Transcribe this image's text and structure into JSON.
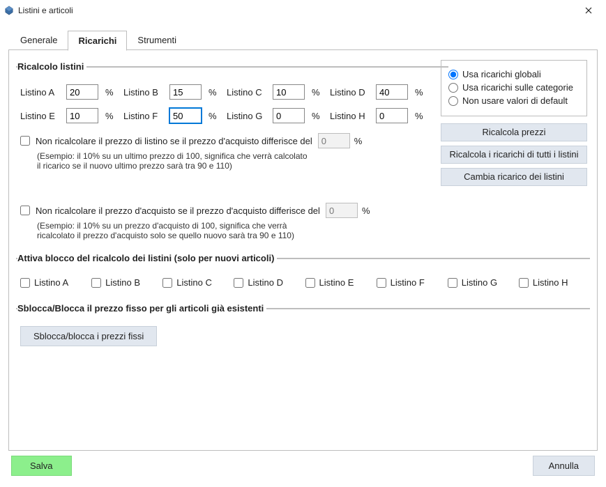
{
  "window": {
    "title": "Listini e articoli"
  },
  "tabs": {
    "generale": "Generale",
    "ricarichi": "Ricarichi",
    "strumenti": "Strumenti",
    "active": "ricarichi"
  },
  "ricalcolo": {
    "legend": "Ricalcolo listini",
    "percent_sign": "%",
    "listini": {
      "a_label": "Listino A",
      "a_value": "20",
      "b_label": "Listino B",
      "b_value": "15",
      "c_label": "Listino C",
      "c_value": "10",
      "d_label": "Listino D",
      "d_value": "40",
      "e_label": "Listino E",
      "e_value": "10",
      "f_label": "Listino F",
      "f_value": "50",
      "g_label": "Listino G",
      "g_value": "0",
      "h_label": "Listino H",
      "h_value": "0"
    },
    "no_recal_listino_label": "Non ricalcolare il prezzo di listino se il prezzo d'acquisto differisce del",
    "no_recal_listino_value": "0",
    "no_recal_listino_example": "(Esempio: il 10% su un ultimo prezzo di 100, significa che verrà calcolato il ricarico se il nuovo ultimo prezzo sarà tra 90 e 110)",
    "no_recal_acquisto_label": "Non ricalcolare il prezzo d'acquisto se il prezzo d'acquisto differisce del",
    "no_recal_acquisto_value": "0",
    "no_recal_acquisto_example": "(Esempio: il 10% su un prezzo d'acquisto di 100, significa che verrà ricalcolato il prezzo d'acquisto solo se quello nuovo sarà tra 90 e 110)"
  },
  "defaults_mode": {
    "globali": "Usa ricarichi globali",
    "categorie": "Usa ricarichi sulle categorie",
    "nessuno": "Non usare valori di default",
    "selected": "globali"
  },
  "buttons": {
    "ricalcola_prezzi": "Ricalcola prezzi",
    "ricalcola_tutti": "Ricalcola i ricarichi di tutti i listini",
    "cambia_ricarico": "Cambia ricarico dei listini",
    "sblocca_blocca": "Sblocca/blocca i prezzi fissi",
    "salva": "Salva",
    "annulla": "Annulla"
  },
  "blocco": {
    "legend": "Attiva blocco del ricalcolo dei listini (solo per nuovi articoli)",
    "items": {
      "a": "Listino A",
      "b": "Listino B",
      "c": "Listino C",
      "d": "Listino D",
      "e": "Listino E",
      "f": "Listino F",
      "g": "Listino G",
      "h": "Listino H"
    }
  },
  "sblocca": {
    "legend": "Sblocca/Blocca il prezzo fisso per gli articoli già esistenti"
  }
}
